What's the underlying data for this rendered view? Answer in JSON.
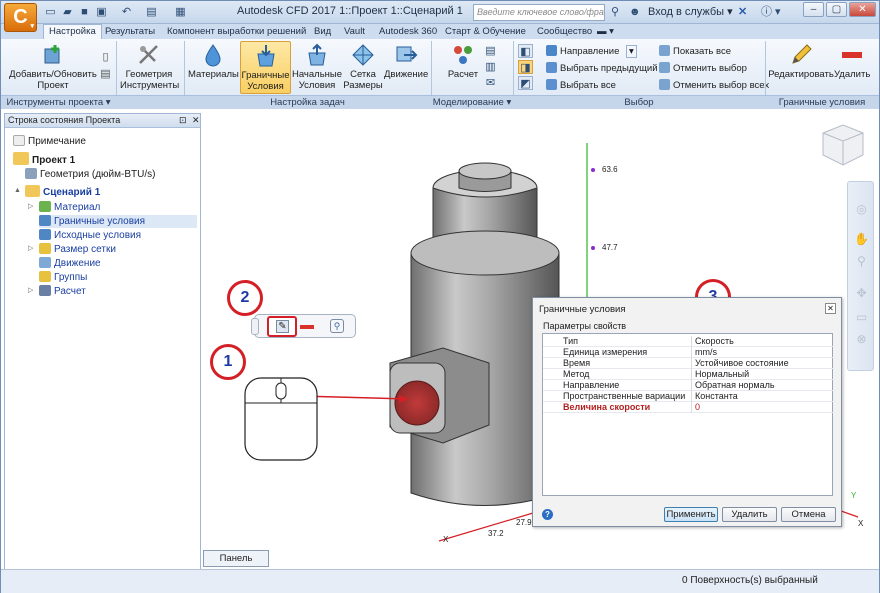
{
  "window": {
    "title": "Autodesk CFD 2017   1::Проект 1::Сценарий 1",
    "search_placeholder": "Введите ключевое слово/фразу",
    "login": "Вход в службы",
    "app_letter": "C"
  },
  "tabs": [
    "Настройка",
    "Результаты",
    "Компонент выработки решений",
    "Вид",
    "Vault",
    "Autodesk 360",
    "Старт & Обучение",
    "Сообщество"
  ],
  "active_tab": "Настройка",
  "ribbon": {
    "project_tools": {
      "add_update": "Добавить/Обновить\nПроект",
      "group": "Инструменты проекта"
    },
    "geometry": {
      "label": "Геометрия\nИнструменты"
    },
    "task": {
      "materials": "Материалы",
      "boundary": "Граничные\nУсловия",
      "initial": "Начальные\nУсловия",
      "mesh": "Сетка\nРазмеры",
      "motion": "Движение",
      "group": "Настройка задач"
    },
    "modeling": {
      "calc": "Расчет",
      "group": "Моделирование"
    },
    "selection": {
      "direction": "Направление",
      "select_prev": "Выбрать предыдущий",
      "select_all": "Выбрать все",
      "show_all": "Показать все",
      "cancel_sel": "Отменить выбор",
      "cancel_all": "Отменить выбор всех",
      "group": "Выбор"
    },
    "bc": {
      "edit": "Редактировать",
      "delete": "Удалить",
      "group": "Граничные условия"
    }
  },
  "panel": {
    "title": "Строка состояния Проекта",
    "items": [
      {
        "label": "Примечание"
      },
      {
        "label": "Проект 1"
      },
      {
        "label": "Геометрия (дюйм-BTU/s)"
      },
      {
        "label": "Сценарий 1"
      },
      {
        "label": "Материал"
      },
      {
        "label": "Граничные условия"
      },
      {
        "label": "Исходные условия"
      },
      {
        "label": "Размер сетки"
      },
      {
        "label": "Движение"
      },
      {
        "label": "Группы"
      },
      {
        "label": "Расчет"
      }
    ]
  },
  "viewport": {
    "axis_labels": [
      "63.6",
      "47.7",
      "27.9",
      "37.2"
    ],
    "axis_letters": [
      "Y",
      "X",
      "X"
    ],
    "callouts": [
      "1",
      "2",
      "3"
    ]
  },
  "dialog": {
    "title": "Граничные условия",
    "section": "Параметры свойств",
    "rows": [
      {
        "key": "Тип",
        "value": "Скорость"
      },
      {
        "key": "Единица измерения",
        "value": "mm/s"
      },
      {
        "key": "Время",
        "value": "Устойчивое состояние"
      },
      {
        "key": "Метод",
        "value": "Нормальный"
      },
      {
        "key": "Направление",
        "value": "Обратная нормаль"
      },
      {
        "key": "Пространственные вариации",
        "value": "Константа"
      },
      {
        "key": "Величина скорости",
        "value": "0"
      }
    ],
    "apply": "Применить",
    "delete": "Удалить",
    "cancel": "Отмена"
  },
  "output_tab": "Панель вывода",
  "status": "0 Поверхность(s) выбранный",
  "colors": {
    "accent": "#d41f26",
    "callout_text": "#1f3aa3",
    "ribbon_bg": "#dce7f4",
    "selected": "#f9cf63"
  }
}
